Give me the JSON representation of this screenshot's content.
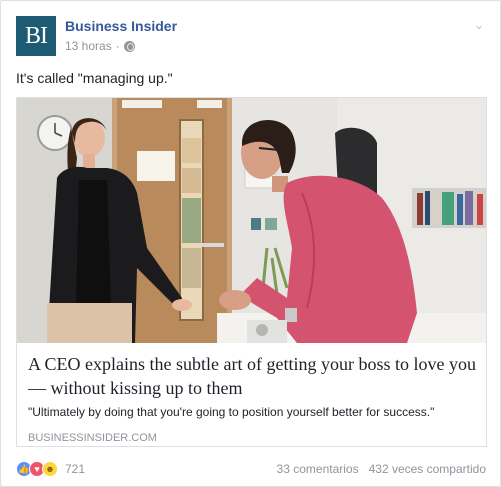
{
  "post": {
    "page_name": "Business Insider",
    "avatar_text": "BI",
    "timestamp": "13 horas",
    "separator": "·",
    "audience_icon": "globe-icon",
    "menu_icon": "chevron-down-icon",
    "text": "It's called \"managing up.\""
  },
  "link_preview": {
    "headline": "A CEO explains the subtle art of getting your boss to love you — without kissing up to them",
    "description": "\"Ultimately by doing that you're going to position yourself better for success.\"",
    "domain": "BUSINESSINSIDER.COM",
    "image_icon": "article-photo"
  },
  "footer": {
    "reaction_icons": [
      "like-reaction-icon",
      "love-reaction-icon",
      "haha-reaction-icon"
    ],
    "reaction_count": "721",
    "comments": "33 comentarios",
    "shares": "432 veces compartido"
  },
  "colors": {
    "link_blue": "#365899",
    "avatar_bg": "#1d5b73",
    "muted": "#90949c"
  }
}
